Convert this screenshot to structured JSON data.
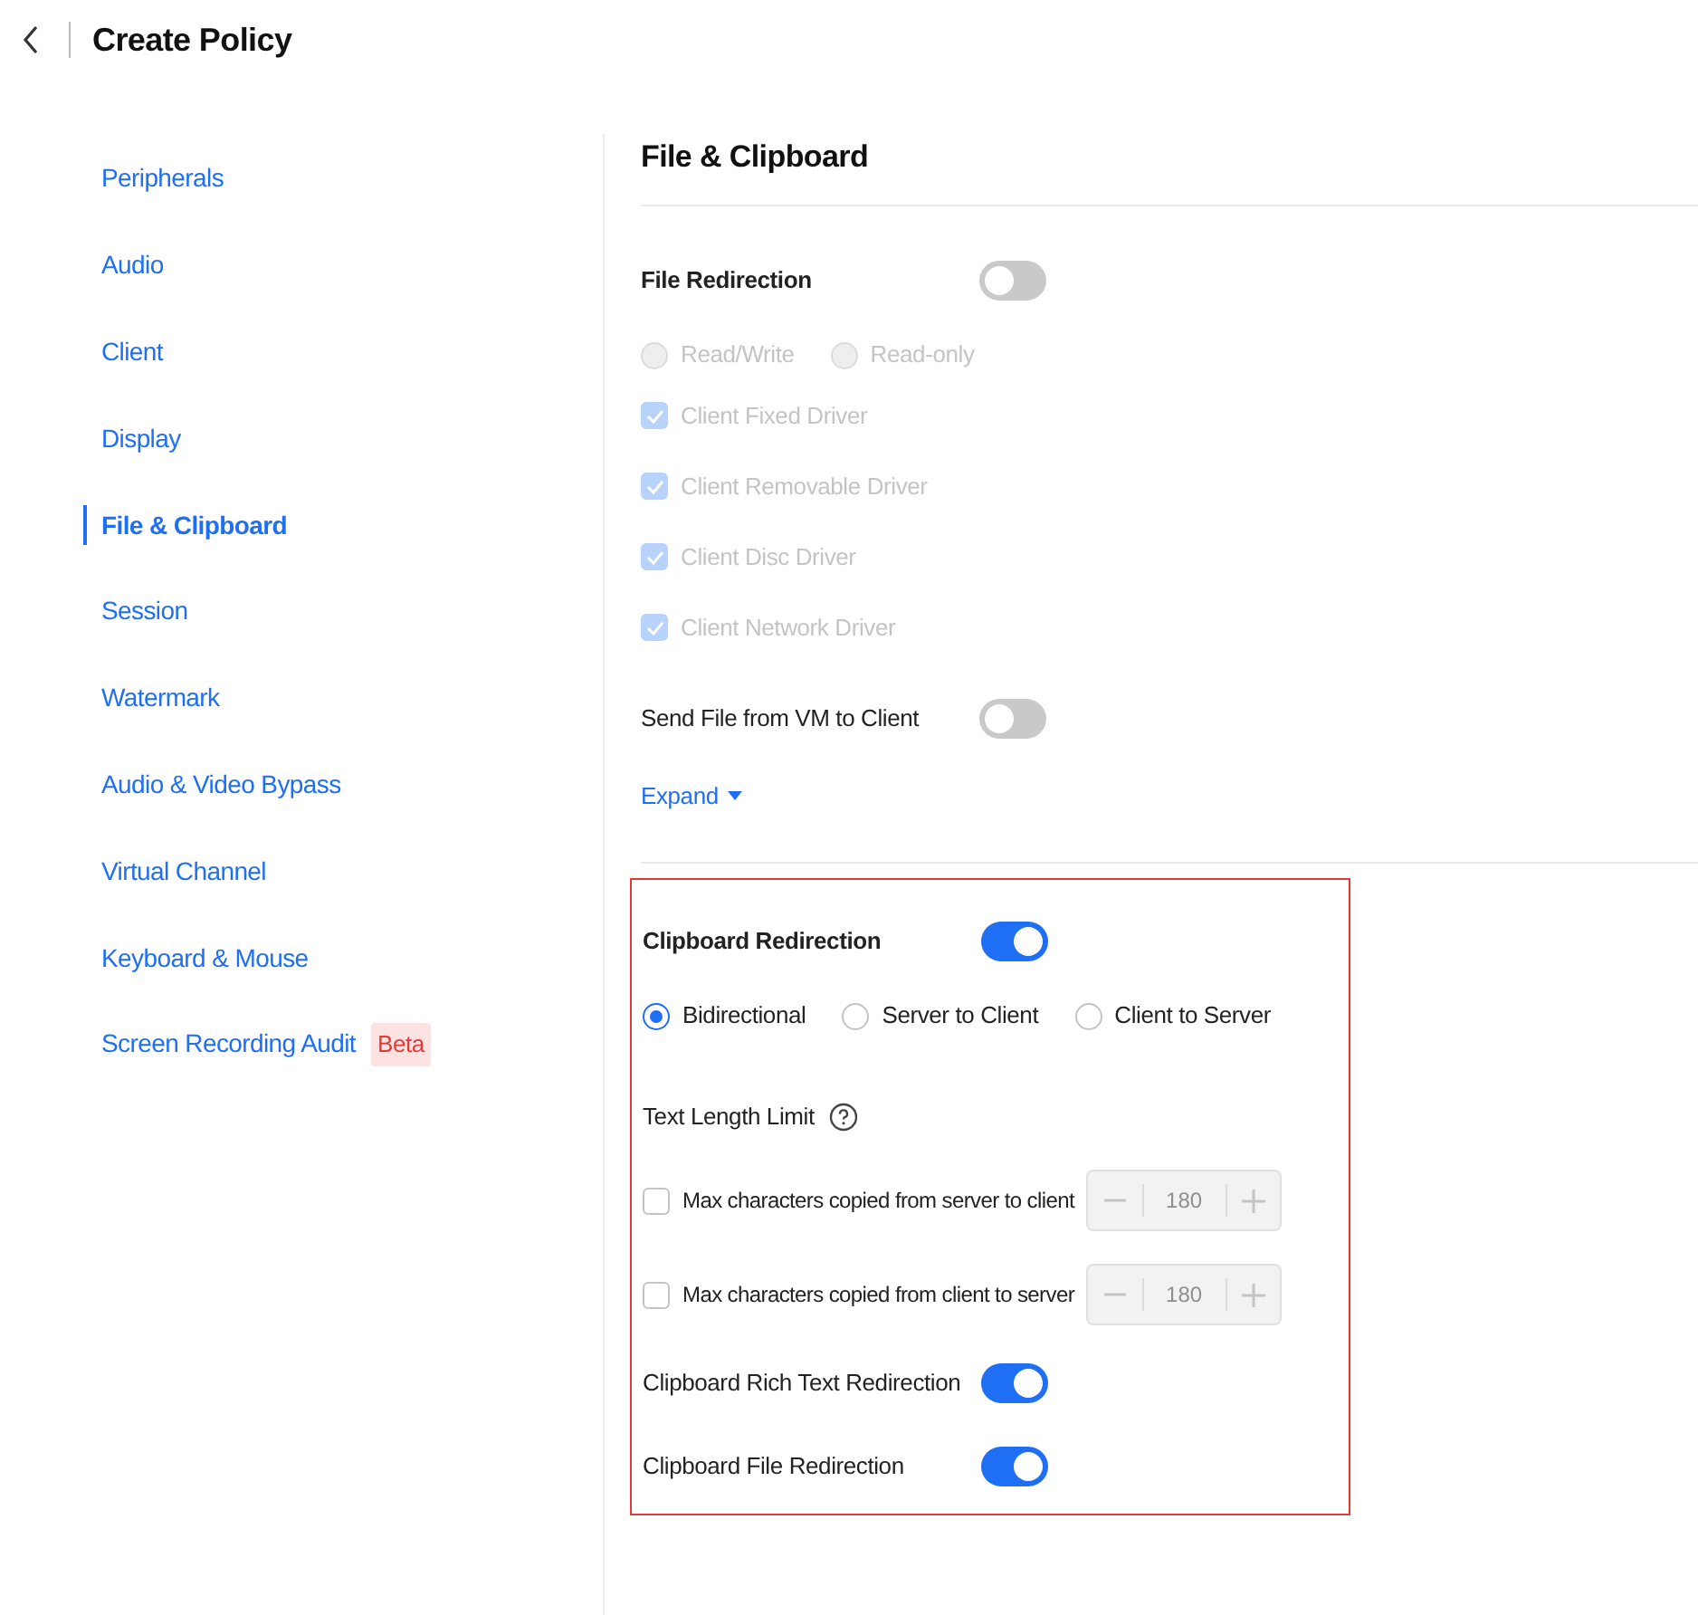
{
  "header": {
    "title": "Create Policy"
  },
  "sidebar": {
    "items": [
      {
        "label": "Peripherals",
        "selected": false
      },
      {
        "label": "Audio",
        "selected": false
      },
      {
        "label": "Client",
        "selected": false
      },
      {
        "label": "Display",
        "selected": false
      },
      {
        "label": "File & Clipboard",
        "selected": true
      },
      {
        "label": "Session",
        "selected": false
      },
      {
        "label": "Watermark",
        "selected": false
      },
      {
        "label": "Audio & Video Bypass",
        "selected": false
      },
      {
        "label": "Virtual Channel",
        "selected": false
      },
      {
        "label": "Keyboard & Mouse",
        "selected": false
      },
      {
        "label": "Screen Recording Audit",
        "selected": false,
        "badge": "Beta"
      }
    ]
  },
  "content": {
    "title": "File & Clipboard",
    "file_group": {
      "rows": [
        {
          "kind": "master_toggle",
          "label": "File Redirection",
          "on": false
        },
        {
          "kind": "radios",
          "options": [
            {
              "label": "Read/Write",
              "selected": false,
              "disabled": true
            },
            {
              "label": "Read-only",
              "selected": false,
              "disabled": true
            }
          ]
        },
        {
          "kind": "checkbox",
          "label": "Client Fixed Driver",
          "checked": true,
          "disabled": true
        },
        {
          "kind": "checkbox",
          "label": "Client Removable Driver",
          "checked": true,
          "disabled": true
        },
        {
          "kind": "checkbox",
          "label": "Client Disc Driver",
          "checked": true,
          "disabled": true
        },
        {
          "kind": "checkbox",
          "label": "Client Network Driver",
          "checked": true,
          "disabled": true
        },
        {
          "kind": "toggle",
          "label": "Send File from VM to Client",
          "on": false
        },
        {
          "kind": "link",
          "label": "Expand"
        }
      ]
    },
    "clipboard_group": {
      "highlighted": true,
      "rows": [
        {
          "kind": "master_toggle",
          "label": "Clipboard Redirection",
          "on": true
        },
        {
          "kind": "radios",
          "options": [
            {
              "label": "Bidirectional",
              "selected": true,
              "disabled": false
            },
            {
              "label": "Server to Client",
              "selected": false,
              "disabled": false
            },
            {
              "label": "Client to Server",
              "selected": false,
              "disabled": false
            }
          ]
        },
        {
          "kind": "heading",
          "label": "Text Length Limit"
        },
        {
          "kind": "limit",
          "label": "Max characters copied from server to client",
          "checked": false,
          "value": "180",
          "disabled": true
        },
        {
          "kind": "limit",
          "label": "Max characters copied from client to server",
          "checked": false,
          "value": "180",
          "disabled": true
        },
        {
          "kind": "toggle",
          "label": "Clipboard Rich Text Redirection",
          "on": true
        },
        {
          "kind": "toggle",
          "label": "Clipboard File Redirection",
          "on": true
        }
      ]
    }
  }
}
